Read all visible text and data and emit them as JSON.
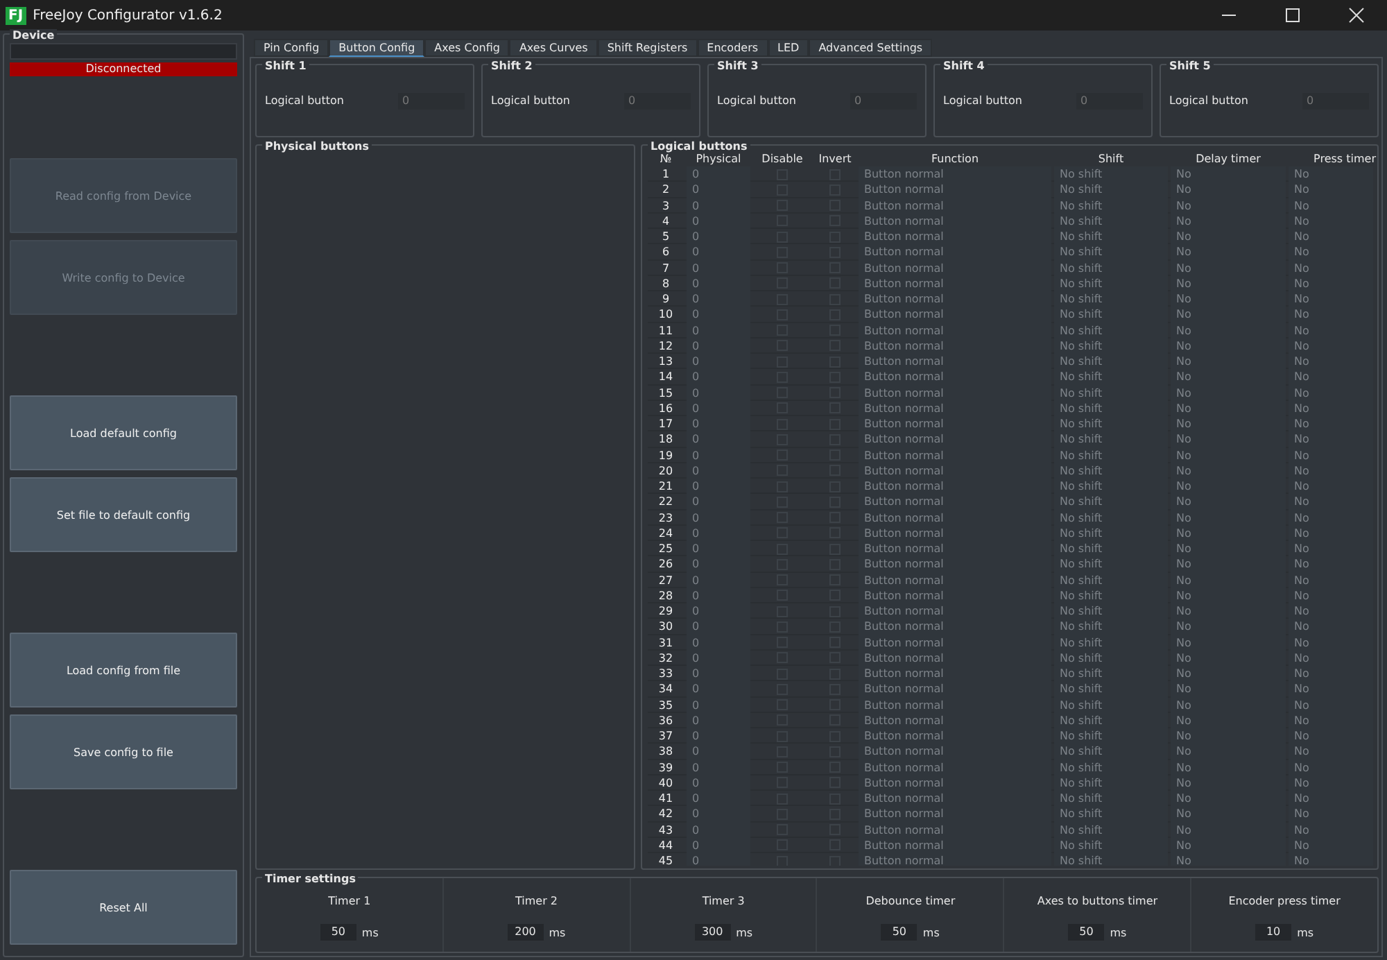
{
  "window": {
    "title": "FreeJoy Configurator v1.6.2",
    "logo": "FJ"
  },
  "device": {
    "title": "Device",
    "status": "Disconnected",
    "connected": false
  },
  "button_groups": [
    [
      {
        "label": "Read config from Device",
        "disabled": true
      },
      {
        "label": "Write config to Device",
        "disabled": true
      }
    ],
    [
      {
        "label": "Load default config",
        "disabled": false
      },
      {
        "label": "Set file to default config",
        "disabled": false
      }
    ],
    [
      {
        "label": "Load config from file",
        "disabled": false
      },
      {
        "label": "Save config to file",
        "disabled": false
      }
    ],
    [
      {
        "label": "Reset All",
        "disabled": false
      }
    ]
  ],
  "tabs": [
    {
      "label": "Pin Config",
      "selected": false
    },
    {
      "label": "Button Config",
      "selected": true
    },
    {
      "label": "Axes Config",
      "selected": false
    },
    {
      "label": "Axes Curves",
      "selected": false
    },
    {
      "label": "Shift Registers",
      "selected": false
    },
    {
      "label": "Encoders",
      "selected": false
    },
    {
      "label": "LED",
      "selected": false
    },
    {
      "label": "Advanced Settings",
      "selected": false
    }
  ],
  "shifts": [
    {
      "title": "Shift 1",
      "label": "Logical button",
      "value": "0"
    },
    {
      "title": "Shift 2",
      "label": "Logical button",
      "value": "0"
    },
    {
      "title": "Shift 3",
      "label": "Logical button",
      "value": "0"
    },
    {
      "title": "Shift 4",
      "label": "Logical button",
      "value": "0"
    },
    {
      "title": "Shift 5",
      "label": "Logical button",
      "value": "0"
    }
  ],
  "physical_buttons": {
    "title": "Physical buttons"
  },
  "logical_buttons": {
    "title": "Logical buttons",
    "columns": [
      "№",
      "Physical",
      "Disable",
      "Invert",
      "Function",
      "Shift",
      "Delay timer",
      "Press timer"
    ],
    "rows": [
      {
        "number": "1",
        "physical": "0",
        "disable": false,
        "invert": false,
        "function": "Button normal",
        "shift": "No shift",
        "delay": "No",
        "press": "No"
      },
      {
        "number": "2",
        "physical": "0",
        "disable": false,
        "invert": false,
        "function": "Button normal",
        "shift": "No shift",
        "delay": "No",
        "press": "No"
      },
      {
        "number": "3",
        "physical": "0",
        "disable": false,
        "invert": false,
        "function": "Button normal",
        "shift": "No shift",
        "delay": "No",
        "press": "No"
      },
      {
        "number": "4",
        "physical": "0",
        "disable": false,
        "invert": false,
        "function": "Button normal",
        "shift": "No shift",
        "delay": "No",
        "press": "No"
      },
      {
        "number": "5",
        "physical": "0",
        "disable": false,
        "invert": false,
        "function": "Button normal",
        "shift": "No shift",
        "delay": "No",
        "press": "No"
      },
      {
        "number": "6",
        "physical": "0",
        "disable": false,
        "invert": false,
        "function": "Button normal",
        "shift": "No shift",
        "delay": "No",
        "press": "No"
      },
      {
        "number": "7",
        "physical": "0",
        "disable": false,
        "invert": false,
        "function": "Button normal",
        "shift": "No shift",
        "delay": "No",
        "press": "No"
      },
      {
        "number": "8",
        "physical": "0",
        "disable": false,
        "invert": false,
        "function": "Button normal",
        "shift": "No shift",
        "delay": "No",
        "press": "No"
      },
      {
        "number": "9",
        "physical": "0",
        "disable": false,
        "invert": false,
        "function": "Button normal",
        "shift": "No shift",
        "delay": "No",
        "press": "No"
      },
      {
        "number": "10",
        "physical": "0",
        "disable": false,
        "invert": false,
        "function": "Button normal",
        "shift": "No shift",
        "delay": "No",
        "press": "No"
      },
      {
        "number": "11",
        "physical": "0",
        "disable": false,
        "invert": false,
        "function": "Button normal",
        "shift": "No shift",
        "delay": "No",
        "press": "No"
      },
      {
        "number": "12",
        "physical": "0",
        "disable": false,
        "invert": false,
        "function": "Button normal",
        "shift": "No shift",
        "delay": "No",
        "press": "No"
      },
      {
        "number": "13",
        "physical": "0",
        "disable": false,
        "invert": false,
        "function": "Button normal",
        "shift": "No shift",
        "delay": "No",
        "press": "No"
      },
      {
        "number": "14",
        "physical": "0",
        "disable": false,
        "invert": false,
        "function": "Button normal",
        "shift": "No shift",
        "delay": "No",
        "press": "No"
      },
      {
        "number": "15",
        "physical": "0",
        "disable": false,
        "invert": false,
        "function": "Button normal",
        "shift": "No shift",
        "delay": "No",
        "press": "No"
      },
      {
        "number": "16",
        "physical": "0",
        "disable": false,
        "invert": false,
        "function": "Button normal",
        "shift": "No shift",
        "delay": "No",
        "press": "No"
      },
      {
        "number": "17",
        "physical": "0",
        "disable": false,
        "invert": false,
        "function": "Button normal",
        "shift": "No shift",
        "delay": "No",
        "press": "No"
      },
      {
        "number": "18",
        "physical": "0",
        "disable": false,
        "invert": false,
        "function": "Button normal",
        "shift": "No shift",
        "delay": "No",
        "press": "No"
      },
      {
        "number": "19",
        "physical": "0",
        "disable": false,
        "invert": false,
        "function": "Button normal",
        "shift": "No shift",
        "delay": "No",
        "press": "No"
      },
      {
        "number": "20",
        "physical": "0",
        "disable": false,
        "invert": false,
        "function": "Button normal",
        "shift": "No shift",
        "delay": "No",
        "press": "No"
      },
      {
        "number": "21",
        "physical": "0",
        "disable": false,
        "invert": false,
        "function": "Button normal",
        "shift": "No shift",
        "delay": "No",
        "press": "No"
      },
      {
        "number": "22",
        "physical": "0",
        "disable": false,
        "invert": false,
        "function": "Button normal",
        "shift": "No shift",
        "delay": "No",
        "press": "No"
      },
      {
        "number": "23",
        "physical": "0",
        "disable": false,
        "invert": false,
        "function": "Button normal",
        "shift": "No shift",
        "delay": "No",
        "press": "No"
      },
      {
        "number": "24",
        "physical": "0",
        "disable": false,
        "invert": false,
        "function": "Button normal",
        "shift": "No shift",
        "delay": "No",
        "press": "No"
      },
      {
        "number": "25",
        "physical": "0",
        "disable": false,
        "invert": false,
        "function": "Button normal",
        "shift": "No shift",
        "delay": "No",
        "press": "No"
      },
      {
        "number": "26",
        "physical": "0",
        "disable": false,
        "invert": false,
        "function": "Button normal",
        "shift": "No shift",
        "delay": "No",
        "press": "No"
      },
      {
        "number": "27",
        "physical": "0",
        "disable": false,
        "invert": false,
        "function": "Button normal",
        "shift": "No shift",
        "delay": "No",
        "press": "No"
      },
      {
        "number": "28",
        "physical": "0",
        "disable": false,
        "invert": false,
        "function": "Button normal",
        "shift": "No shift",
        "delay": "No",
        "press": "No"
      },
      {
        "number": "29",
        "physical": "0",
        "disable": false,
        "invert": false,
        "function": "Button normal",
        "shift": "No shift",
        "delay": "No",
        "press": "No"
      },
      {
        "number": "30",
        "physical": "0",
        "disable": false,
        "invert": false,
        "function": "Button normal",
        "shift": "No shift",
        "delay": "No",
        "press": "No"
      },
      {
        "number": "31",
        "physical": "0",
        "disable": false,
        "invert": false,
        "function": "Button normal",
        "shift": "No shift",
        "delay": "No",
        "press": "No"
      },
      {
        "number": "32",
        "physical": "0",
        "disable": false,
        "invert": false,
        "function": "Button normal",
        "shift": "No shift",
        "delay": "No",
        "press": "No"
      },
      {
        "number": "33",
        "physical": "0",
        "disable": false,
        "invert": false,
        "function": "Button normal",
        "shift": "No shift",
        "delay": "No",
        "press": "No"
      },
      {
        "number": "34",
        "physical": "0",
        "disable": false,
        "invert": false,
        "function": "Button normal",
        "shift": "No shift",
        "delay": "No",
        "press": "No"
      },
      {
        "number": "35",
        "physical": "0",
        "disable": false,
        "invert": false,
        "function": "Button normal",
        "shift": "No shift",
        "delay": "No",
        "press": "No"
      },
      {
        "number": "36",
        "physical": "0",
        "disable": false,
        "invert": false,
        "function": "Button normal",
        "shift": "No shift",
        "delay": "No",
        "press": "No"
      },
      {
        "number": "37",
        "physical": "0",
        "disable": false,
        "invert": false,
        "function": "Button normal",
        "shift": "No shift",
        "delay": "No",
        "press": "No"
      },
      {
        "number": "38",
        "physical": "0",
        "disable": false,
        "invert": false,
        "function": "Button normal",
        "shift": "No shift",
        "delay": "No",
        "press": "No"
      },
      {
        "number": "39",
        "physical": "0",
        "disable": false,
        "invert": false,
        "function": "Button normal",
        "shift": "No shift",
        "delay": "No",
        "press": "No"
      },
      {
        "number": "40",
        "physical": "0",
        "disable": false,
        "invert": false,
        "function": "Button normal",
        "shift": "No shift",
        "delay": "No",
        "press": "No"
      },
      {
        "number": "41",
        "physical": "0",
        "disable": false,
        "invert": false,
        "function": "Button normal",
        "shift": "No shift",
        "delay": "No",
        "press": "No"
      },
      {
        "number": "42",
        "physical": "0",
        "disable": false,
        "invert": false,
        "function": "Button normal",
        "shift": "No shift",
        "delay": "No",
        "press": "No"
      },
      {
        "number": "43",
        "physical": "0",
        "disable": false,
        "invert": false,
        "function": "Button normal",
        "shift": "No shift",
        "delay": "No",
        "press": "No"
      },
      {
        "number": "44",
        "physical": "0",
        "disable": false,
        "invert": false,
        "function": "Button normal",
        "shift": "No shift",
        "delay": "No",
        "press": "No"
      },
      {
        "number": "45",
        "physical": "0",
        "disable": false,
        "invert": false,
        "function": "Button normal",
        "shift": "No shift",
        "delay": "No",
        "press": "No"
      }
    ]
  },
  "timer_settings": {
    "title": "Timer settings",
    "timers": [
      {
        "label": "Timer 1",
        "value": "50",
        "unit": "ms"
      },
      {
        "label": "Timer 2",
        "value": "200",
        "unit": "ms"
      },
      {
        "label": "Timer 3",
        "value": "300",
        "unit": "ms"
      },
      {
        "label": "Debounce timer",
        "value": "50",
        "unit": "ms"
      },
      {
        "label": "Axes to buttons timer",
        "value": "50",
        "unit": "ms"
      },
      {
        "label": "Encoder press timer",
        "value": "10",
        "unit": "ms"
      }
    ]
  }
}
